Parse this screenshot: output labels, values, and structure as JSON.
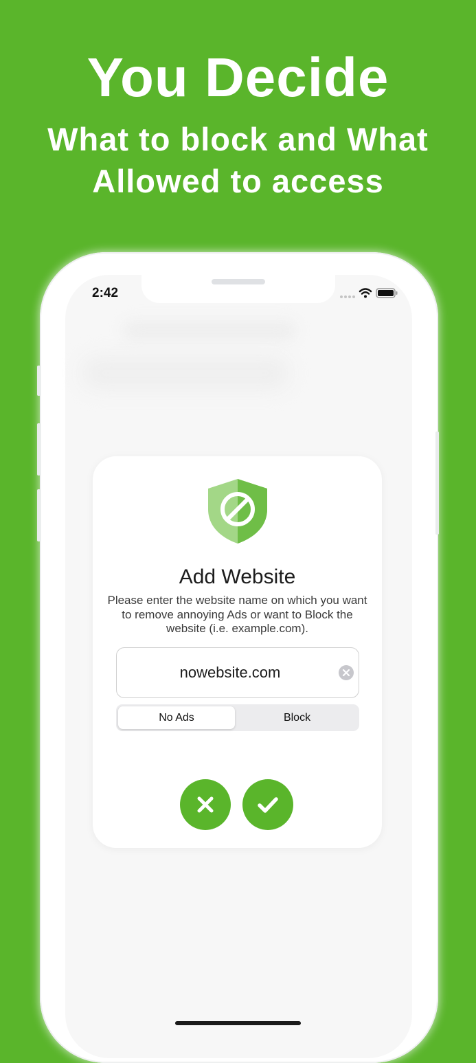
{
  "marketing": {
    "headline": "You Decide",
    "subline_1": "What to block and What",
    "subline_2": "Allowed to access"
  },
  "status_bar": {
    "time": "2:42",
    "icons": [
      "cellular-dots-icon",
      "wifi-icon",
      "battery-icon"
    ]
  },
  "dialog": {
    "icon": "shield-block-icon",
    "title": "Add Website",
    "description": "Please enter the website name on which you want to remove annoying Ads or want to Block the website (i.e. example.com).",
    "input_value": "nowebsite.com",
    "segment_options": [
      "No Ads",
      "Block"
    ],
    "segment_selected": "No Ads",
    "cancel_icon": "close-icon",
    "confirm_icon": "checkmark-icon"
  },
  "colors": {
    "background": "#5ab52b",
    "accent": "#5ab52b",
    "shield_light": "#a3d787",
    "shield_dark": "#6fbe47"
  }
}
